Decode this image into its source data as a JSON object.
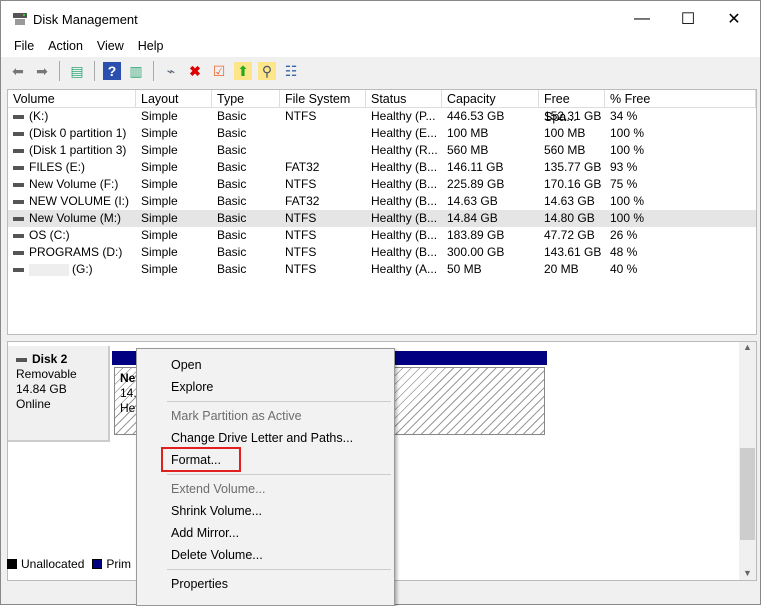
{
  "window": {
    "title": "Disk Management",
    "minimize": "—",
    "maximize": "☐",
    "close": "✕"
  },
  "menu": [
    "File",
    "Action",
    "View",
    "Help"
  ],
  "columns": [
    "Volume",
    "Layout",
    "Type",
    "File System",
    "Status",
    "Capacity",
    "Free Spa...",
    "% Free"
  ],
  "rows": [
    [
      "(K:)",
      "Simple",
      "Basic",
      "NTFS",
      "Healthy (P...",
      "446.53 GB",
      "152.31 GB",
      "34 %"
    ],
    [
      "(Disk 0 partition 1)",
      "Simple",
      "Basic",
      "",
      "Healthy (E...",
      "100 MB",
      "100 MB",
      "100 %"
    ],
    [
      "(Disk 1 partition 3)",
      "Simple",
      "Basic",
      "",
      "Healthy (R...",
      "560 MB",
      "560 MB",
      "100 %"
    ],
    [
      "FILES (E:)",
      "Simple",
      "Basic",
      "FAT32",
      "Healthy (B...",
      "146.11 GB",
      "135.77 GB",
      "93 %"
    ],
    [
      "New Volume (F:)",
      "Simple",
      "Basic",
      "NTFS",
      "Healthy (B...",
      "225.89 GB",
      "170.16 GB",
      "75 %"
    ],
    [
      "NEW VOLUME (I:)",
      "Simple",
      "Basic",
      "FAT32",
      "Healthy (B...",
      "14.63 GB",
      "14.63 GB",
      "100 %"
    ],
    [
      "New Volume (M:)",
      "Simple",
      "Basic",
      "NTFS",
      "Healthy (B...",
      "14.84 GB",
      "14.80 GB",
      "100 %"
    ],
    [
      "OS (C:)",
      "Simple",
      "Basic",
      "NTFS",
      "Healthy (B...",
      "183.89 GB",
      "47.72 GB",
      "26 %"
    ],
    [
      "PROGRAMS (D:)",
      "Simple",
      "Basic",
      "NTFS",
      "Healthy (B...",
      "300.00 GB",
      "143.61 GB",
      "48 %"
    ],
    [
      "(G:)",
      "Simple",
      "Basic",
      "NTFS",
      "Healthy (A...",
      "50 MB",
      "20 MB",
      "40 %"
    ]
  ],
  "disk": {
    "name": "Disk 2",
    "type": "Removable",
    "size": "14.84 GB",
    "status": "Online"
  },
  "partition": {
    "line1": "New",
    "line2": "14.8",
    "line3": "Hea"
  },
  "legend": {
    "unallocated": "Unallocated",
    "primary": "Prim"
  },
  "context_menu": {
    "open": "Open",
    "explore": "Explore",
    "mark_active": "Mark Partition as Active",
    "change_letter": "Change Drive Letter and Paths...",
    "format": "Format...",
    "extend": "Extend Volume...",
    "shrink": "Shrink Volume...",
    "mirror": "Add Mirror...",
    "delete": "Delete Volume...",
    "properties": "Properties"
  }
}
